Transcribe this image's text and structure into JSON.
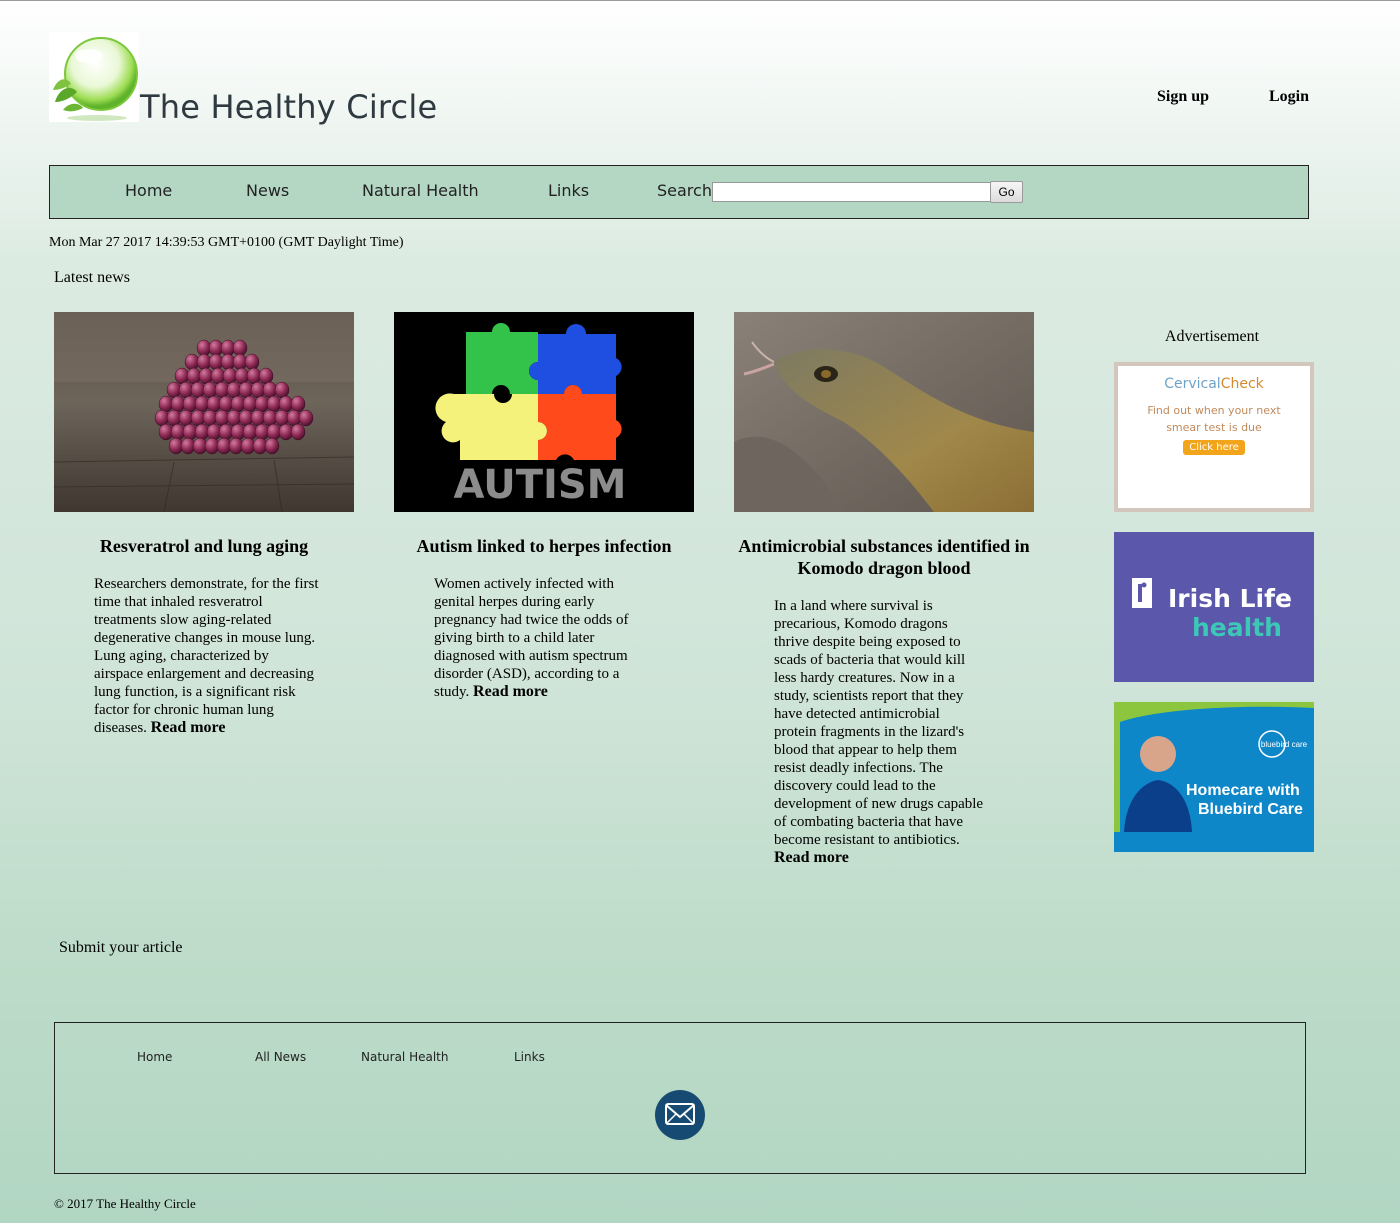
{
  "header": {
    "site_title": "The Healthy Circle",
    "signup_label": "Sign up",
    "login_label": "Login"
  },
  "nav": {
    "items": [
      "Home",
      "News",
      "Natural Health",
      "Links"
    ],
    "search_label": "Search",
    "search_value": "",
    "go_label": "Go"
  },
  "date_text": "Mon Mar 27 2017 14:39:53 GMT+0100 (GMT Daylight Time)",
  "latest_news_label": "Latest news",
  "articles": [
    {
      "image_text": "",
      "title": "Resveratrol and lung aging",
      "body": "Researchers demonstrate, for the first time that inhaled resveratrol treatments slow aging-related degenerative changes in mouse lung. Lung aging, characterized by airspace enlargement and decreasing lung function, is a significant risk factor for chronic human lung diseases.",
      "read_more": "Read more"
    },
    {
      "image_text": "AUTISM",
      "title": "Autism linked to herpes infection",
      "body": "Women actively infected with genital herpes during early pregnancy had twice the odds of giving birth to a child later diagnosed with autism spectrum disorder (ASD), according to a study.",
      "read_more": "Read more"
    },
    {
      "image_text": "",
      "title": "Antimicrobial substances identified in Komodo dragon blood",
      "body": "In a land where survival is precarious, Komodo dragons thrive despite being exposed to scads of bacteria that would kill less hardy creatures. Now in a study, scientists report that they have detected antimicrobial protein fragments in the lizard's blood that appear to help them resist deadly infections. The discovery could lead to the development of new drugs capable of combating bacteria that have become resistant to antibiotics.",
      "read_more": "Read more"
    }
  ],
  "ads": {
    "label": "Advertisement",
    "cervical": {
      "brand_a": "Cervical",
      "brand_b": "Check",
      "line1": "Find out when your next",
      "line2": "smear test is due",
      "button": "Click here"
    },
    "irishlife": {
      "line1": "Irish Life",
      "line2": "health"
    },
    "bluebird": {
      "logo": "bluebird care",
      "line1": "Homecare with",
      "line2": "Bluebird Care"
    }
  },
  "submit_label": "Submit your article",
  "footer": {
    "links": [
      "Home",
      "All News",
      "Natural Health",
      "Links"
    ],
    "copyright": "© 2017 The Healthy Circle"
  },
  "icons": {
    "logo": "green-bubble-logo-icon",
    "mail": "envelope-icon"
  },
  "colors": {
    "nav_bg": "#b3d7c3",
    "mail_bg": "#174a72",
    "irishlife_bg": "#5b57aa",
    "bluebird_bg": "#0d87c8"
  }
}
